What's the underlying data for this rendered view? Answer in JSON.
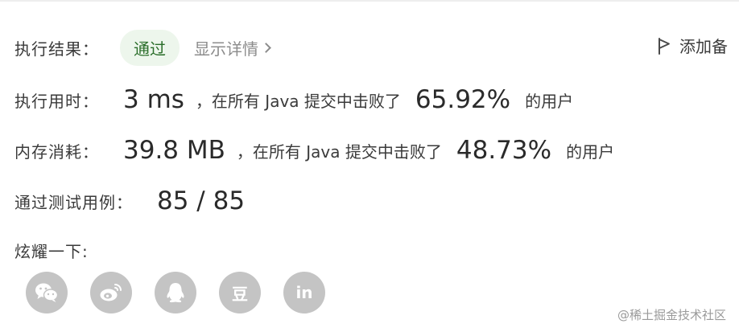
{
  "result": {
    "label": "执行结果：",
    "status": "通过",
    "details_link": "显示详情",
    "add_note": "添加备"
  },
  "runtime": {
    "label": "执行用时：",
    "value": "3 ms",
    "middle": "，在所有 Java 提交中击败了",
    "percent": "65.92%",
    "suffix": "的用户"
  },
  "memory": {
    "label": "内存消耗：",
    "value": "39.8 MB",
    "middle": "，在所有 Java 提交中击败了",
    "percent": "48.73%",
    "suffix": "的用户"
  },
  "tests": {
    "label": "通过测试用例：",
    "value": "85 / 85"
  },
  "share": {
    "label": "炫耀一下:",
    "icons": [
      "wechat-icon",
      "weibo-icon",
      "qq-icon",
      "douban-icon",
      "linkedin-icon"
    ],
    "douban_glyph": "豆",
    "linkedin_glyph": "in"
  },
  "watermark": "@稀土掘金技术社区",
  "colors": {
    "status_bg": "#edf6ec",
    "status_text": "#2a6e2a",
    "share_icon_bg": "#c4c4c4",
    "muted": "#8c8c8c"
  }
}
